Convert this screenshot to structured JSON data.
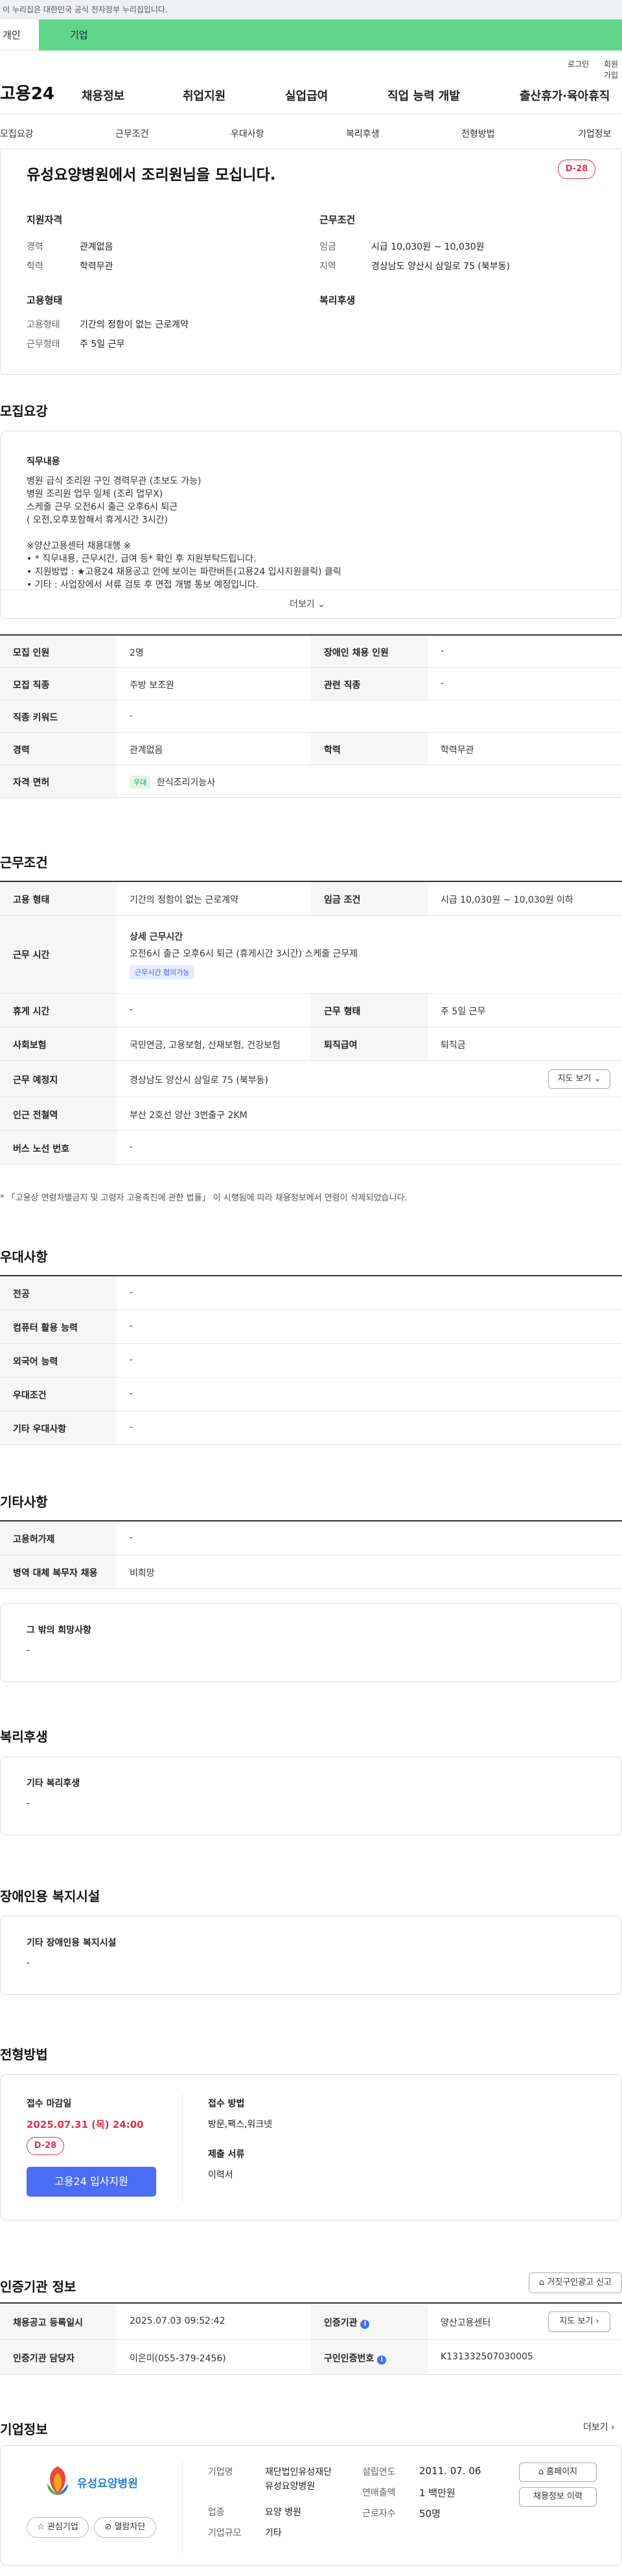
{
  "banner": {
    "text": "이 누리집은 대한민국 공식 전자정부 누리집입니다."
  },
  "tabs": {
    "personal": "개인",
    "company": "기업"
  },
  "util": {
    "login": "로그인",
    "signup": "회원가입"
  },
  "gnb": {
    "logo": "고용24",
    "menu": [
      "채용정보",
      "취업지원",
      "실업급여",
      "직업 능력 개발",
      "출산휴가·육아휴직"
    ]
  },
  "subnav": [
    "모집요강",
    "근무조건",
    "우대사항",
    "복리후생",
    "전형방법",
    "기업정보"
  ],
  "header": {
    "title": "유성요양병원에서 조리원님을 모십니다.",
    "dday": "D-28",
    "qual_title": "지원자격",
    "qual": [
      {
        "k": "경력",
        "v": "관계없음"
      },
      {
        "k": "학력",
        "v": "학력무관"
      }
    ],
    "cond_title": "근무조건",
    "cond": [
      {
        "k": "임금",
        "v": "시급 10,030원 ~ 10,030원"
      },
      {
        "k": "지역",
        "v": "경상남도 양산시 삼일로 75 (북부동)"
      }
    ],
    "emp_title": "고용형태",
    "emp": [
      {
        "k": "고용형태",
        "v": "기간의 정함이 없는 근로계약"
      },
      {
        "k": "근무형태",
        "v": "주 5일 근무"
      }
    ],
    "welfare_title": "복리후생"
  },
  "recruit": {
    "title": "모집요강",
    "desc_title": "직무내용",
    "desc": [
      "병원 급식 조리원 구인 경력무관 (초보도 가능)",
      "병원 조리원 업무 일체 (조리 업무X)",
      "스케줄 근무 오전6시 출근 오후6시 퇴근",
      "( 오전,오후포함해서 휴게시간 3시간)",
      "",
      "※양산고용센터 채용대행 ※",
      "• * 직무내용, 근무시간, 급여 등* 확인 후 지원부탁드립니다.",
      "• 지원방법 : ★고용24 채용공고 안에 보이는 파란버튼(고용24 입사지원클릭) 클릭",
      "• 기타 : 사업장에서 서류 검토 후 면접 개별 통보 예정입니다."
    ],
    "more": "더보기",
    "rows": [
      {
        "k1": "모집 인원",
        "v1": "2명",
        "k2": "장애인 채용 인원",
        "v2": "-"
      },
      {
        "k1": "모집 직종",
        "v1": "주방 보조원",
        "k2": "관련 직종",
        "v2": "-"
      },
      {
        "k1": "직종 키워드",
        "v1": "-"
      },
      {
        "k1": "경력",
        "v1": "관계없음",
        "k2": "학력",
        "v2": "학력무관"
      },
      {
        "k1": "자격 면허",
        "badge": "우대",
        "v1": "한식조리기능사"
      }
    ]
  },
  "work": {
    "title": "근무조건",
    "emp_k": "고용 형태",
    "emp_v": "기간의 정함이 없는 근로계약",
    "wage_k": "임금 조건",
    "wage_v": "시급 10,030원 ~ 10,030원 이하",
    "time_k": "근무 시간",
    "time_title": "상세 근무시간",
    "time_v": "오전6시 출근 오후6시 퇴근 (휴게시간 3시간) 스케줄 근무제",
    "time_badge": "근무시간 협의가능",
    "rest_k": "휴게 시간",
    "rest_v": "-",
    "form_k": "근무 형태",
    "form_v": "주 5일 근무",
    "ins_k": "사회보험",
    "ins_v": "국민연금, 고용보험, 산재보험, 건강보험",
    "ret_k": "퇴직급여",
    "ret_v": "퇴직금",
    "place_k": "근무 예정지",
    "place_v": "경상남도 양산시 삼일로 75 (북부동)",
    "map_btn": "지도 보기",
    "station_k": "인근 전철역",
    "station_v": "부산 2호선 양산 3번출구 2KM",
    "bus_k": "버스 노선 번호",
    "bus_v": "-",
    "note": "* 「고용상 연령차별금지 및 고령자 고용촉진에 관한 법률」 이 시행됨에 따라 채용정보에서 연령이 삭제되었습니다."
  },
  "pref": {
    "title": "우대사항",
    "rows": [
      {
        "k": "전공",
        "v": "-"
      },
      {
        "k": "컴퓨터 활용 능력",
        "v": "-"
      },
      {
        "k": "외국어 능력",
        "v": "-"
      },
      {
        "k": "우대조건",
        "v": "-"
      },
      {
        "k": "기타 우대사항",
        "v": "-"
      }
    ]
  },
  "etc": {
    "title": "기타사항",
    "rows": [
      {
        "k": "고용허가제",
        "v": "-"
      },
      {
        "k": "병역 대체 복무자 채용",
        "v": "비희망"
      }
    ],
    "box_title": "그 밖의 희망사항",
    "box_v": "-"
  },
  "welfare": {
    "title": "복리후생",
    "box_title": "기타 복리후생",
    "box_v": "-"
  },
  "disabled": {
    "title": "장애인용 복지시설",
    "box_title": "기타 장애인용 복지시설",
    "box_v": "-"
  },
  "selection": {
    "title": "전형방법",
    "deadline_k": "접수 마감일",
    "deadline_v": "2025.07.31 (목) 24:00",
    "dday": "D-28",
    "apply": "고용24 입사지원",
    "method_k": "접수 방법",
    "method_v": "방문,팩스,워크넷",
    "docs_k": "제출 서류",
    "docs_v": "이력서"
  },
  "agency": {
    "title": "인증기관 정보",
    "report_btn": "거짓구인광고 신고",
    "reg_k": "채용공고 등록일시",
    "reg_v": "2025.07.03 09:52:42",
    "org_k": "인증기관",
    "org_v": "양산고용센터",
    "map_btn": "지도 보기",
    "mgr_k": "인증기관 담당자",
    "mgr_v": "이은미(055-379-2456)",
    "no_k": "구인인증번호",
    "no_v": "K131332507030005"
  },
  "company": {
    "title": "기업정보",
    "more": "더보기",
    "logo_text": "유성요양병원",
    "fav": "관심기업",
    "block": "열람차단",
    "name_k": "기업명",
    "name_v1": "재단법인유성재단",
    "name_v2": "유성요양병원",
    "ind_k": "업종",
    "ind_v": "요양 병원",
    "size_k": "기업규모",
    "size_v": "기타",
    "est_k": "설립연도",
    "est_v": "2011. 07. 06",
    "sales_k": "연매출액",
    "sales_v": "1 백만원",
    "emp_k": "근로자수",
    "emp_v": "50명",
    "home_btn": "홈페이지",
    "hist_btn": "채용정보 이력"
  },
  "colors": {
    "accent": "#4c6ef5",
    "dday": "#e0304e",
    "green": "#5fd68a"
  }
}
